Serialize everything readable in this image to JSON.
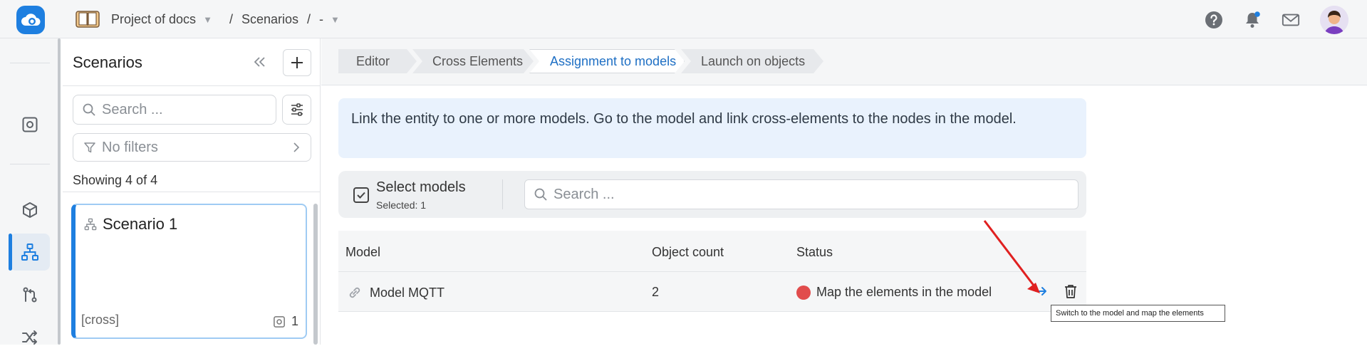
{
  "header": {
    "project": "Project of docs",
    "section": "Scenarios",
    "current": "-",
    "separator": "/"
  },
  "panel": {
    "title": "Scenarios",
    "search_placeholder": "Search ...",
    "filters_label": "No filters",
    "showing": "Showing 4 of 4",
    "cards": [
      {
        "title": "Scenario 1",
        "tag": "[cross]",
        "count": "1"
      }
    ]
  },
  "tabs": [
    {
      "label": "Editor"
    },
    {
      "label": "Cross Elements"
    },
    {
      "label": "Assignment to models"
    },
    {
      "label": "Launch on objects"
    }
  ],
  "info": "Link the entity to one or more models. Go to the model and link cross-elements to the nodes in the model.",
  "select": {
    "title": "Select models",
    "selected": "Selected: 1",
    "search_placeholder": "Search ..."
  },
  "table": {
    "columns": [
      "Model",
      "Object count",
      "Status"
    ],
    "rows": [
      {
        "model": "Model MQTT",
        "count": "2",
        "status": "Map the elements in the model"
      }
    ]
  },
  "tooltip": "Switch to the model and map the elements",
  "colors": {
    "accent": "#1e7fe0",
    "status_error": "#e14c4c",
    "annotation": "#e02020"
  }
}
